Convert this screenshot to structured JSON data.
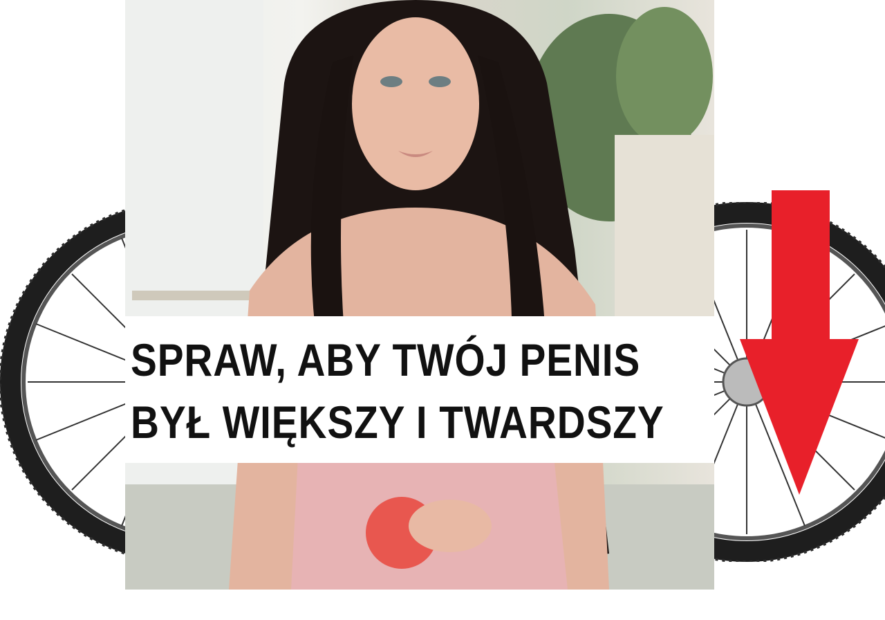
{
  "headline": {
    "line1": "SPRAW, ABY TWÓJ PENIS",
    "line2": "BYŁ WIĘKSZY I TWARDSZY"
  },
  "colors": {
    "arrow": "#e8202a",
    "text": "#111111",
    "background": "#ffffff",
    "tire": "#222222"
  },
  "icons": [
    "bicycle-wheel-icon",
    "down-arrow-icon"
  ]
}
